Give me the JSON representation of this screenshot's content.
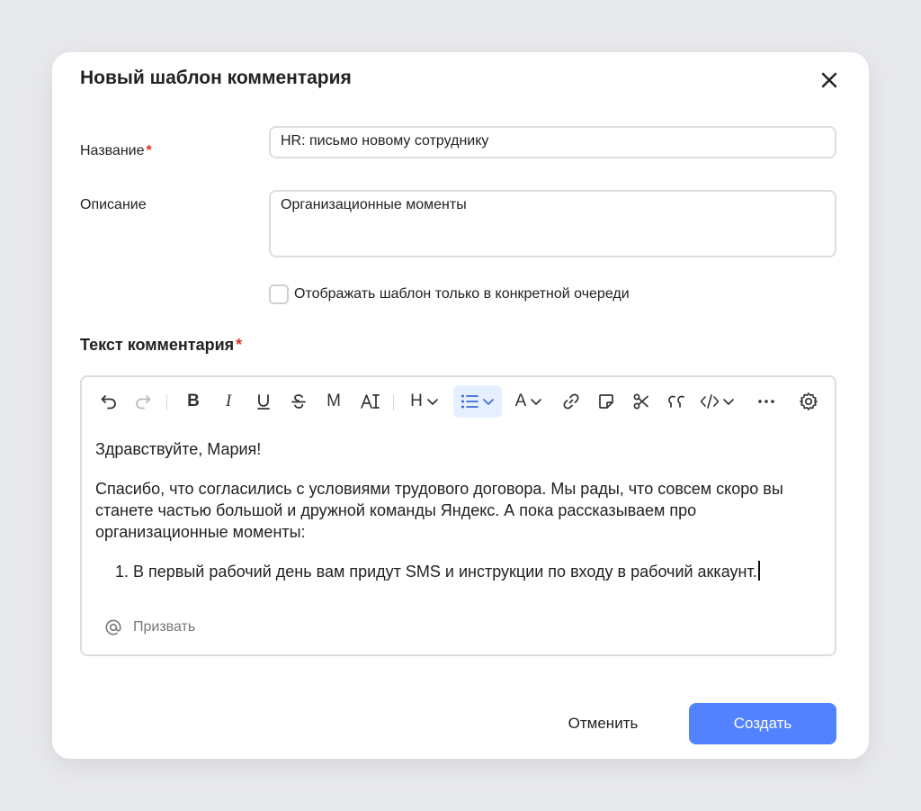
{
  "dialog": {
    "title": "Новый шаблон комментария"
  },
  "form": {
    "name_label": "Название",
    "name_required_mark": "*",
    "name_value": "HR: письмо новому сотруднику",
    "description_label": "Описание",
    "description_value": "Организационные моменты",
    "queue_checkbox_label": "Отображать шаблон только в конкретной очереди",
    "queue_checkbox_checked": false,
    "comment_label": "Текст комментария",
    "comment_required_mark": "*"
  },
  "toolbar": {
    "icons": [
      "undo-icon",
      "redo-icon",
      "bold-icon",
      "italic-icon",
      "underline-icon",
      "strikethrough-icon",
      "monospace-icon",
      "text-size-icon",
      "heading-icon",
      "list-icon",
      "text-color-icon",
      "link-icon",
      "note-icon",
      "cut-icon",
      "quote-icon",
      "code-icon",
      "more-icon",
      "settings-icon"
    ],
    "heading_glyph": "H",
    "text_color_glyph": "A",
    "monospace_glyph": "M",
    "bold_glyph": "B",
    "italic_glyph": "I",
    "active_color": "#3d6ad6"
  },
  "editor": {
    "greeting": "Здравствуйте, Мария!",
    "paragraph": "Спасибо, что согласились с условиями трудового договора. Мы рады, что совсем скоро вы станете частью большой и дружной команды Яндекс. А пока рассказываем про организационные моменты:",
    "list_items": [
      "В первый рабочий день вам придут SMS и инструкции по входу в рабочий аккаунт."
    ],
    "mention_label": "Призвать"
  },
  "actions": {
    "cancel_label": "Отменить",
    "create_label": "Создать",
    "primary_color": "#5282ff"
  }
}
